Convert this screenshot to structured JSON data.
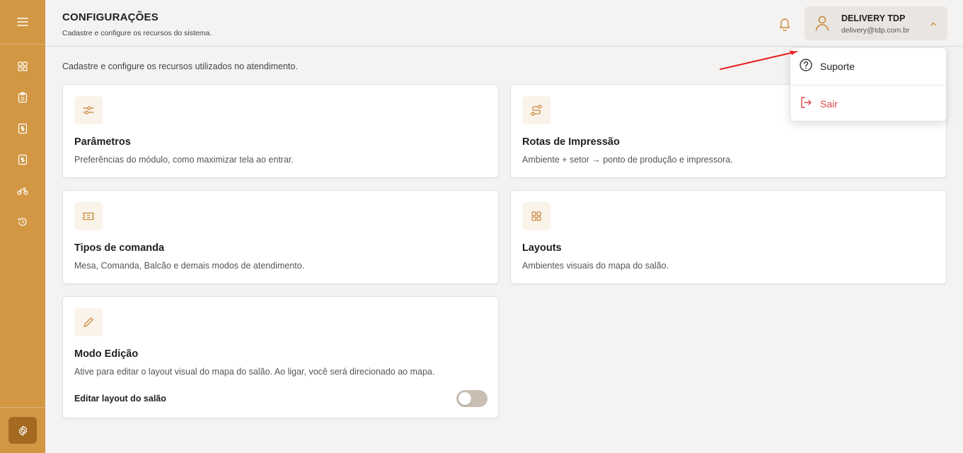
{
  "header": {
    "title": "CONFIGURAÇÕES",
    "subtitle": "Cadastre e configure os recursos do sistema."
  },
  "user": {
    "name": "DELIVERY TDP",
    "email": "delivery@tdp.com.br"
  },
  "intro": "Cadastre e configure os recursos utilizados no atendimento.",
  "cards": [
    {
      "title": "Parâmetros",
      "desc": "Preferências do módulo, como maximizar tela ao entrar.",
      "icon": "sliders-icon"
    },
    {
      "title": "Rotas de Impressão",
      "desc": "Ambiente + setor → ponto de produção e impressora.",
      "icon": "route-icon"
    },
    {
      "title": "Tipos de comanda",
      "desc": "Mesa, Comanda, Balcão e demais modos de atendimento.",
      "icon": "ticket-icon"
    },
    {
      "title": "Layouts",
      "desc": "Ambientes visuais do mapa do salão.",
      "icon": "grid-icon"
    },
    {
      "title": "Modo Edição",
      "desc": "Ative para editar o layout visual do mapa do salão. Ao ligar, você será direcionado ao mapa.",
      "icon": "pencil-icon",
      "toggle_label": "Editar layout do salão",
      "toggle_on": false
    }
  ],
  "dropdown": {
    "items": [
      {
        "label": "Suporte",
        "icon": "help-circle-icon"
      },
      {
        "label": "Sair",
        "icon": "logout-icon"
      }
    ]
  },
  "sidebar": {
    "items": [
      "dashboard-icon",
      "clipboard-icon",
      "dollar-doc-icon",
      "dollar-doc-icon",
      "motorcycle-icon",
      "history-icon"
    ],
    "bottom": "gear-icon"
  },
  "colors": {
    "sidebar": "#d39744",
    "accent": "#c9893a",
    "danger": "#e04848",
    "annotation_arrow": "#e82020"
  }
}
